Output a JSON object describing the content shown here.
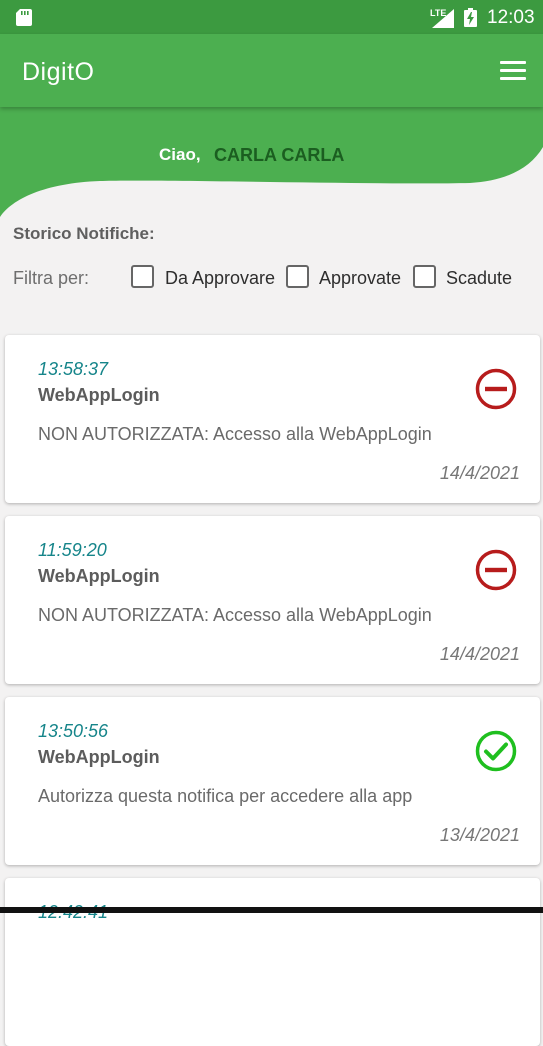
{
  "status_bar": {
    "network": "LTE",
    "time": "12:03"
  },
  "app_bar": {
    "title": "DigitO"
  },
  "greeting": {
    "hello": "Ciao,",
    "user_name": "CARLA CARLA"
  },
  "history": {
    "title": "Storico Notifiche:"
  },
  "filters": {
    "label": "Filtra per:",
    "options": [
      {
        "label": "Da Approvare",
        "checked": false
      },
      {
        "label": "Approvate",
        "checked": false
      },
      {
        "label": "Scadute",
        "checked": false
      }
    ]
  },
  "notifications": [
    {
      "time": "13:58:37",
      "app": "WebAppLogin",
      "message": "NON AUTORIZZATA: Accesso alla WebAppLogin",
      "date": "14/4/2021",
      "status": "denied",
      "status_icon": "minus-circle-icon",
      "status_color": "#b71c1c"
    },
    {
      "time": "11:59:20",
      "app": "WebAppLogin",
      "message": "NON AUTORIZZATA: Accesso alla WebAppLogin",
      "date": "14/4/2021",
      "status": "denied",
      "status_icon": "minus-circle-icon",
      "status_color": "#b71c1c"
    },
    {
      "time": "13:50:56",
      "app": "WebAppLogin",
      "message": "Autorizza questa notifica per accedere alla app",
      "date": "13/4/2021",
      "status": "approved",
      "status_icon": "check-circle-icon",
      "status_color": "#1fbf1f"
    },
    {
      "time": "12:42:41",
      "app": "",
      "message": "",
      "date": "",
      "status": "",
      "status_icon": "",
      "status_color": ""
    }
  ],
  "colors": {
    "primary": "#4caf50",
    "status_bar": "#3c9a40",
    "greeting_name": "#1b5e20",
    "time_text": "#16858a"
  }
}
